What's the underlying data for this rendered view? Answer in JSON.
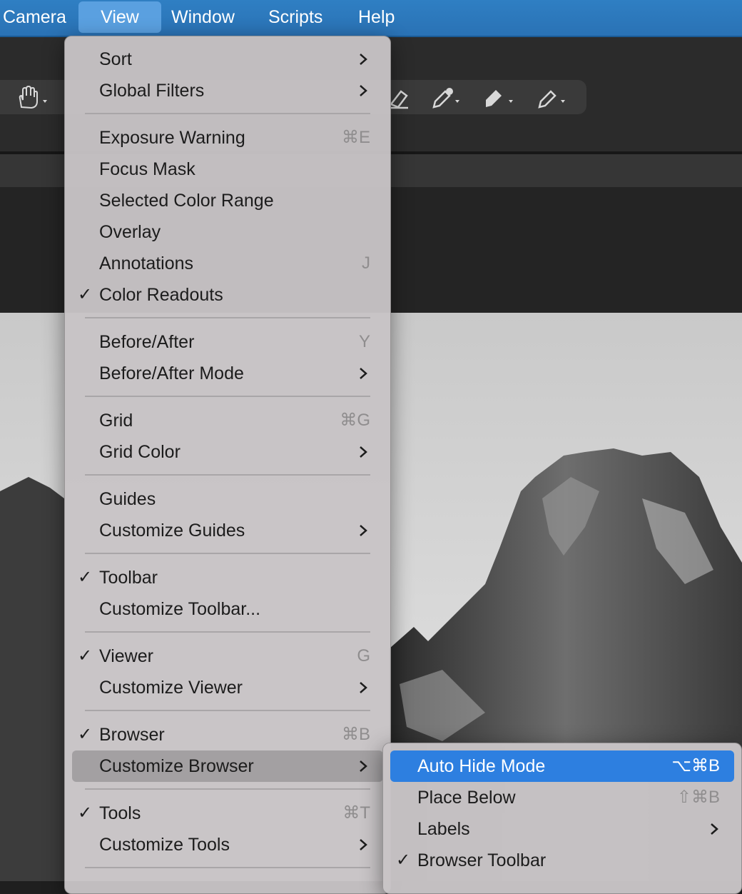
{
  "menubar": {
    "items": [
      "Camera",
      "View",
      "Window",
      "Scripts",
      "Help"
    ]
  },
  "toolbar": {
    "tools": [
      "hand-tool-icon",
      "eraser-tool-icon",
      "color-picker-tool-icon",
      "stamp-tool-icon",
      "annotation-pen-tool-icon"
    ]
  },
  "view_menu": {
    "sort": "Sort",
    "global_filters": "Global Filters",
    "exposure_warning": "Exposure Warning",
    "exposure_warning_sc": "⌘E",
    "focus_mask": "Focus Mask",
    "selected_color_range": "Selected Color Range",
    "overlay": "Overlay",
    "annotations": "Annotations",
    "annotations_sc": "J",
    "color_readouts": "Color Readouts",
    "before_after": "Before/After",
    "before_after_sc": "Y",
    "before_after_mode": "Before/After Mode",
    "grid": "Grid",
    "grid_sc": "⌘G",
    "grid_color": "Grid Color",
    "guides": "Guides",
    "customize_guides": "Customize Guides",
    "toolbar": "Toolbar",
    "customize_toolbar": "Customize Toolbar...",
    "viewer": "Viewer",
    "viewer_sc": "G",
    "customize_viewer": "Customize Viewer",
    "browser": "Browser",
    "browser_sc": "⌘B",
    "customize_browser": "Customize Browser",
    "tools": "Tools",
    "tools_sc": "⌘T",
    "customize_tools": "Customize Tools",
    "check": "✓"
  },
  "browser_submenu": {
    "auto_hide_mode": "Auto Hide Mode",
    "auto_hide_mode_sc": "⌥⌘B",
    "place_below": "Place Below",
    "place_below_sc": "⇧⌘B",
    "labels": "Labels",
    "browser_toolbar": "Browser Toolbar"
  },
  "colors": {
    "menubar": "#2f7fc3",
    "highlight": "#2d7fe0"
  }
}
